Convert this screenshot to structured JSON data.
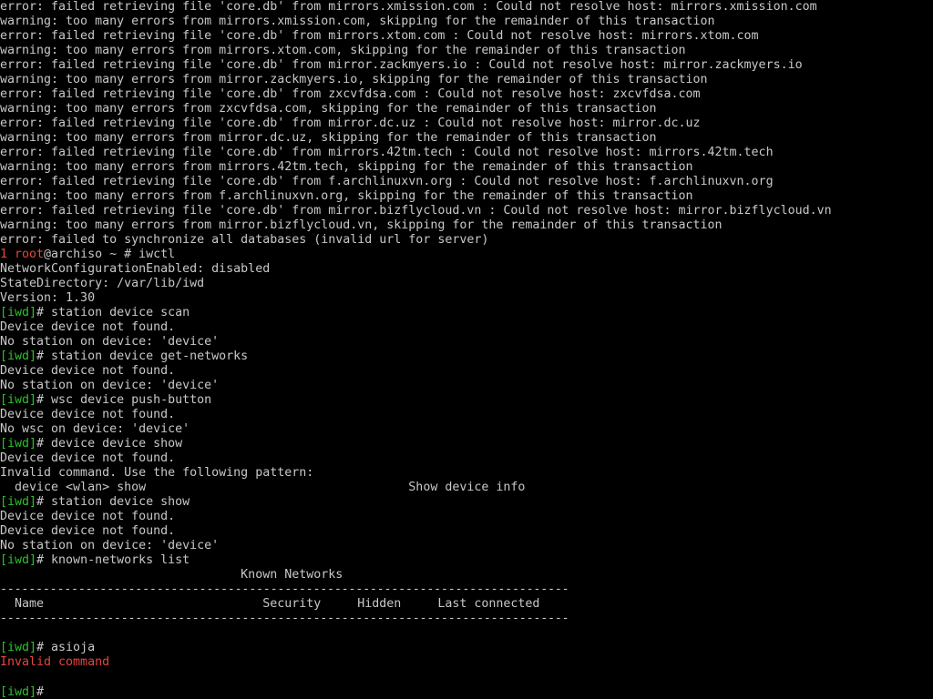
{
  "colors": {
    "background": "#000000",
    "text": "#c8c8c8",
    "error_red": "#e8453c",
    "iwd_green": "#29c229"
  },
  "terminal": {
    "lines": [
      [
        {
          "t": "error: failed retrieving file 'core.db' from mirrors.xmission.com : Could not resolve host: mirrors.xmission.com",
          "c": "default"
        }
      ],
      [
        {
          "t": "warning: too many errors from mirrors.xmission.com, skipping for the remainder of this transaction",
          "c": "default"
        }
      ],
      [
        {
          "t": "error: failed retrieving file 'core.db' from mirrors.xtom.com : Could not resolve host: mirrors.xtom.com",
          "c": "default"
        }
      ],
      [
        {
          "t": "warning: too many errors from mirrors.xtom.com, skipping for the remainder of this transaction",
          "c": "default"
        }
      ],
      [
        {
          "t": "error: failed retrieving file 'core.db' from mirror.zackmyers.io : Could not resolve host: mirror.zackmyers.io",
          "c": "default"
        }
      ],
      [
        {
          "t": "warning: too many errors from mirror.zackmyers.io, skipping for the remainder of this transaction",
          "c": "default"
        }
      ],
      [
        {
          "t": "error: failed retrieving file 'core.db' from zxcvfdsa.com : Could not resolve host: zxcvfdsa.com",
          "c": "default"
        }
      ],
      [
        {
          "t": "warning: too many errors from zxcvfdsa.com, skipping for the remainder of this transaction",
          "c": "default"
        }
      ],
      [
        {
          "t": "error: failed retrieving file 'core.db' from mirror.dc.uz : Could not resolve host: mirror.dc.uz",
          "c": "default"
        }
      ],
      [
        {
          "t": "warning: too many errors from mirror.dc.uz, skipping for the remainder of this transaction",
          "c": "default"
        }
      ],
      [
        {
          "t": "error: failed retrieving file 'core.db' from mirrors.42tm.tech : Could not resolve host: mirrors.42tm.tech",
          "c": "default"
        }
      ],
      [
        {
          "t": "warning: too many errors from mirrors.42tm.tech, skipping for the remainder of this transaction",
          "c": "default"
        }
      ],
      [
        {
          "t": "error: failed retrieving file 'core.db' from f.archlinuxvn.org : Could not resolve host: f.archlinuxvn.org",
          "c": "default"
        }
      ],
      [
        {
          "t": "warning: too many errors from f.archlinuxvn.org, skipping for the remainder of this transaction",
          "c": "default"
        }
      ],
      [
        {
          "t": "error: failed retrieving file 'core.db' from mirror.bizflycloud.vn : Could not resolve host: mirror.bizflycloud.vn",
          "c": "default"
        }
      ],
      [
        {
          "t": "warning: too many errors from mirror.bizflycloud.vn, skipping for the remainder of this transaction",
          "c": "default"
        }
      ],
      [
        {
          "t": "error: failed to synchronize all databases (invalid url for server)",
          "c": "default"
        }
      ],
      [
        {
          "t": "1 ",
          "c": "red"
        },
        {
          "t": "root",
          "c": "red"
        },
        {
          "t": "@archiso ~ # iwctl",
          "c": "default"
        }
      ],
      [
        {
          "t": "NetworkConfigurationEnabled: disabled",
          "c": "default"
        }
      ],
      [
        {
          "t": "StateDirectory: /var/lib/iwd",
          "c": "default"
        }
      ],
      [
        {
          "t": "Version: 1.30",
          "c": "default"
        }
      ],
      [
        {
          "t": "[iwd]",
          "c": "green"
        },
        {
          "t": "# station device scan",
          "c": "default"
        }
      ],
      [
        {
          "t": "Device device not found.",
          "c": "default"
        }
      ],
      [
        {
          "t": "No station on device: 'device'",
          "c": "default"
        }
      ],
      [
        {
          "t": "[iwd]",
          "c": "green"
        },
        {
          "t": "# station device get-networks",
          "c": "default"
        }
      ],
      [
        {
          "t": "Device device not found.",
          "c": "default"
        }
      ],
      [
        {
          "t": "No station on device: 'device'",
          "c": "default"
        }
      ],
      [
        {
          "t": "[iwd]",
          "c": "green"
        },
        {
          "t": "# wsc device push-button",
          "c": "default"
        }
      ],
      [
        {
          "t": "Device device not found.",
          "c": "default"
        }
      ],
      [
        {
          "t": "No wsc on device: 'device'",
          "c": "default"
        }
      ],
      [
        {
          "t": "[iwd]",
          "c": "green"
        },
        {
          "t": "# device device show",
          "c": "default"
        }
      ],
      [
        {
          "t": "Device device not found.",
          "c": "default"
        }
      ],
      [
        {
          "t": "Invalid command. Use the following pattern:",
          "c": "default"
        }
      ],
      [
        {
          "t": "  device <wlan> show                                    Show device info",
          "c": "default"
        }
      ],
      [
        {
          "t": "[iwd]",
          "c": "green"
        },
        {
          "t": "# station device show",
          "c": "default"
        }
      ],
      [
        {
          "t": "Device device not found.",
          "c": "default"
        }
      ],
      [
        {
          "t": "Device device not found.",
          "c": "default"
        }
      ],
      [
        {
          "t": "No station on device: 'device'",
          "c": "default"
        }
      ],
      [
        {
          "t": "[iwd]",
          "c": "green"
        },
        {
          "t": "# known-networks list",
          "c": "default"
        }
      ],
      [
        {
          "t": "                                 Known Networks",
          "c": "default"
        }
      ],
      [
        {
          "t": "--------------------------------------------------------------------------------",
          "c": "default"
        }
      ],
      [
        {
          "t": "  Name                              Security     Hidden     Last connected",
          "c": "default"
        }
      ],
      [
        {
          "t": "--------------------------------------------------------------------------------",
          "c": "default"
        }
      ],
      [
        {
          "t": "",
          "c": "default"
        }
      ],
      [
        {
          "t": "[iwd]",
          "c": "green"
        },
        {
          "t": "# asioja",
          "c": "default"
        }
      ],
      [
        {
          "t": "Invalid command",
          "c": "red"
        }
      ],
      [
        {
          "t": "",
          "c": "default"
        }
      ],
      [
        {
          "t": "[iwd]",
          "c": "green"
        },
        {
          "t": "# ",
          "c": "default"
        }
      ]
    ]
  }
}
